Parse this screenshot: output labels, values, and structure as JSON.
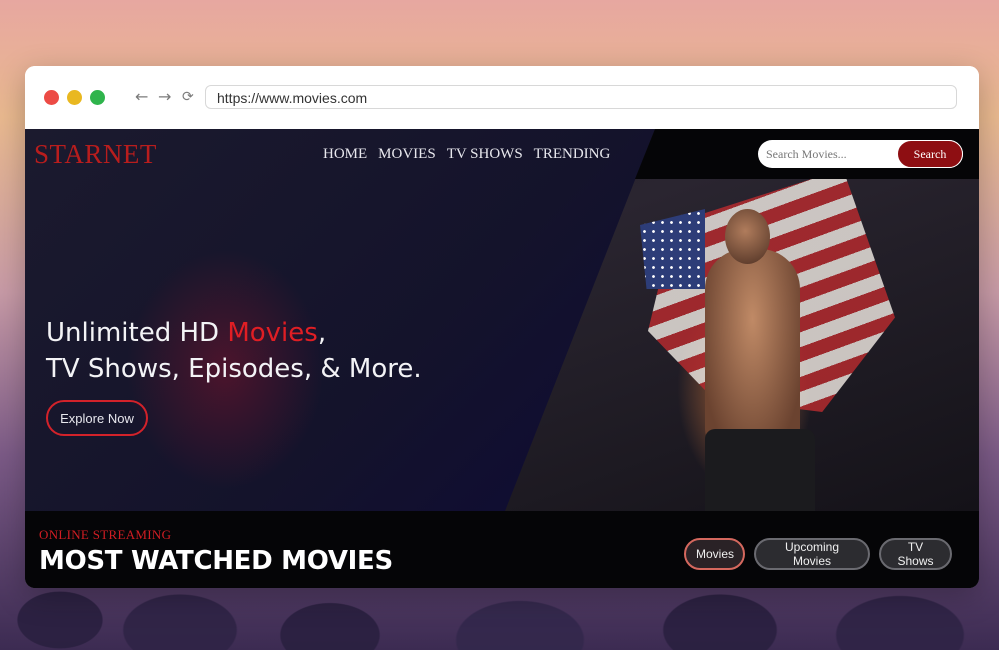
{
  "browser": {
    "url": "https://www.movies.com",
    "back_icon": "arrow-left-icon",
    "forward_icon": "arrow-right-icon",
    "reload_icon": "reload-icon"
  },
  "site": {
    "logo": "STARNET",
    "nav": [
      {
        "label": "HOME"
      },
      {
        "label": "MOVIES"
      },
      {
        "label": "TV SHOWS"
      },
      {
        "label": "TRENDING"
      }
    ],
    "search": {
      "placeholder": "Search Movies...",
      "button_label": "Search"
    },
    "hero": {
      "title_part1": "Unlimited HD ",
      "title_highlight": "Movies",
      "title_part2": ",",
      "title_line2": "TV Shows, Episodes, & More.",
      "cta_label": "Explore Now"
    },
    "section": {
      "kicker": "ONLINE STREAMING",
      "title": "MOST WATCHED MOVIES",
      "filters": [
        {
          "label": "Movies",
          "active": true
        },
        {
          "label": "Upcoming Movies",
          "active": false
        },
        {
          "label": "TV Shows",
          "active": false
        }
      ]
    }
  },
  "colors": {
    "brand_red": "#b81d1d",
    "accent_red": "#e01e24",
    "search_button": "#8e0e12",
    "dark_bg": "#0b0a1c"
  }
}
